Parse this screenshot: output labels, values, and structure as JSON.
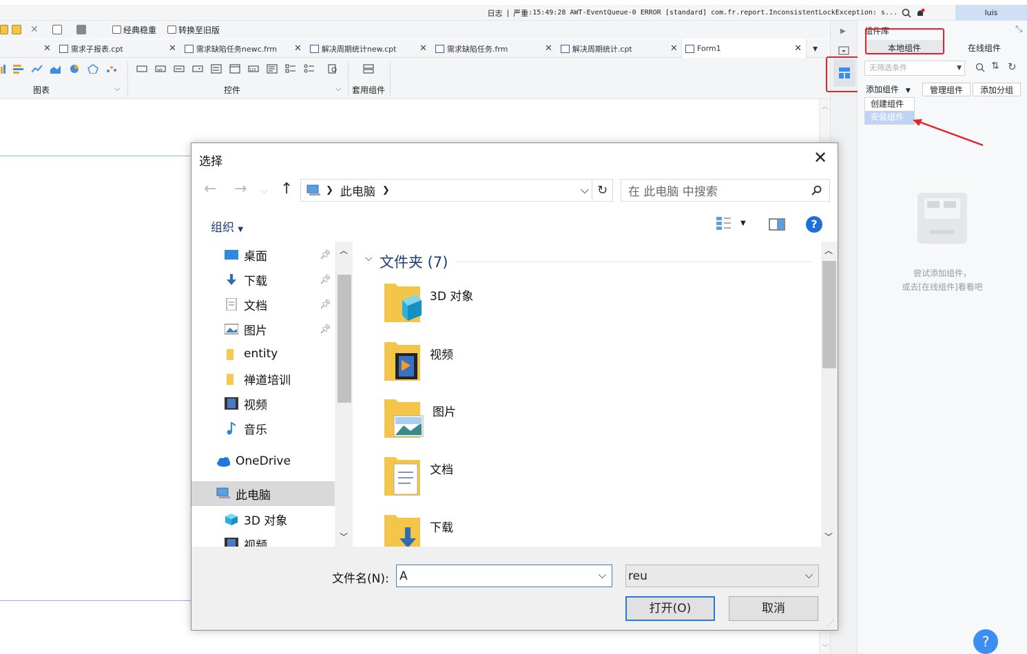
{
  "statusbar": {
    "log_label": "日志",
    "separator": "|",
    "severity": "严重",
    "log_message": ":15:49:28 AWT-EventQueue-0 ERROR [standard] com.fr.report.InconsistentLockException: s...",
    "username": "luis"
  },
  "toolbar": {
    "classic_label": "经典稳重",
    "convert_label": "转换至旧版"
  },
  "tabs": [
    {
      "label": "需求子报表.cpt"
    },
    {
      "label": "需求缺陷任务newc.frm"
    },
    {
      "label": "解决周期统计new.cpt"
    },
    {
      "label": "需求缺陷任务.frm"
    },
    {
      "label": "解决周期统计.cpt"
    },
    {
      "label": "Form1"
    }
  ],
  "ribbon": {
    "chart_label": "图表",
    "widget_label": "控件",
    "package_label": "套用组件"
  },
  "panel": {
    "title": "组件库",
    "local_tab": "本地组件",
    "online_tab": "在线组件",
    "filter_placeholder": "无筛选条件",
    "add_component": "添加组件",
    "manage_component": "管理组件",
    "add_group": "添加分组",
    "menu_create": "创建组件",
    "menu_install": "安装组件",
    "empty_line1": "尝试添加组件，",
    "empty_line2": "或去[在线组件]看看吧",
    "help": "?"
  },
  "dialog": {
    "title": "选择",
    "close": "✕",
    "path": "此电脑",
    "search_placeholder": "在 此电脑 中搜索",
    "organize": "组织",
    "group_header": "文件夹 (7)",
    "nav_items": [
      {
        "label": "桌面"
      },
      {
        "label": "下载"
      },
      {
        "label": "文档"
      },
      {
        "label": "图片"
      },
      {
        "label": "entity"
      },
      {
        "label": "禅道培训"
      },
      {
        "label": "视频"
      },
      {
        "label": "音乐"
      },
      {
        "label": "OneDrive"
      },
      {
        "label": "此电脑"
      },
      {
        "label": "3D 对象"
      },
      {
        "label": "视频"
      }
    ],
    "folders": [
      {
        "label": "3D 对象"
      },
      {
        "label": "视频"
      },
      {
        "label": "图片"
      },
      {
        "label": "文档"
      },
      {
        "label": "下载"
      }
    ],
    "filename_label": "文件名(N):",
    "filename_value": "A",
    "filetype_value": "reu",
    "open_button": "打开(O)",
    "cancel_button": "取消"
  },
  "colors": {
    "accent_red": "#e8202a",
    "selection_blue": "#2a78d4",
    "nav_selected": "#d9d9d9"
  }
}
